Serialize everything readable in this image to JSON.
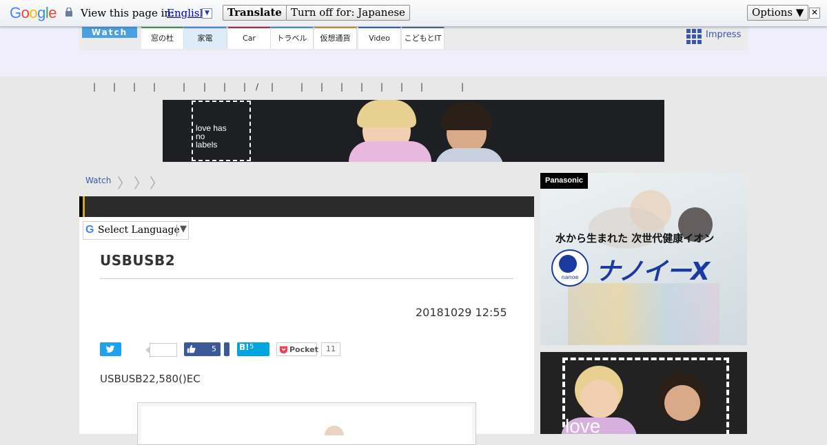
{
  "translate_bar": {
    "logo": "Google",
    "label": "View this page in:",
    "language": "English",
    "translate_btn": "Translate",
    "turn_off_btn": "Turn off for: Japanese",
    "options_btn": "Options ▼",
    "close": "✕"
  },
  "site": {
    "logo": "Watch",
    "tabs": [
      {
        "label": "窓の杜",
        "color": "#5aa05a"
      },
      {
        "label": "家電",
        "color": "#4aa0e0"
      },
      {
        "label": "Car",
        "color": "#c03050"
      },
      {
        "label": "トラベル",
        "color": "#50a8c8"
      },
      {
        "label": "仮想通貨",
        "color": "#e0a030"
      },
      {
        "label": "Video",
        "color": "#3a70c0"
      },
      {
        "label": "こどもとIT",
        "color": "#5a7090"
      }
    ],
    "impress": "Impress"
  },
  "subnav": [
    "|",
    "|",
    "|",
    "|",
    "|",
    "|",
    "|",
    "|",
    "/",
    "|",
    "|",
    "|",
    "|",
    "|",
    "|",
    "|",
    "|",
    "|"
  ],
  "banner": {
    "tagline": "love has no labels"
  },
  "breadcrumb": {
    "root": "Watch"
  },
  "select_language": {
    "label": "Select Language",
    "arrow": "▼"
  },
  "article": {
    "title": "USBUSB2",
    "date": "20181029 12:55",
    "body": "USBUSB22,580()EC"
  },
  "share": {
    "like_count": "5",
    "hatena_label": "B!",
    "hatena_count": "5",
    "pocket_label": "Pocket",
    "pocket_count": "11"
  },
  "ad_panasonic": {
    "brand": "Panasonic",
    "headline": "水から生まれた 次世代健康イオン",
    "product": "ナノイーX",
    "logo_text": "nanoe"
  },
  "ad_love": {
    "tagline": "love"
  }
}
